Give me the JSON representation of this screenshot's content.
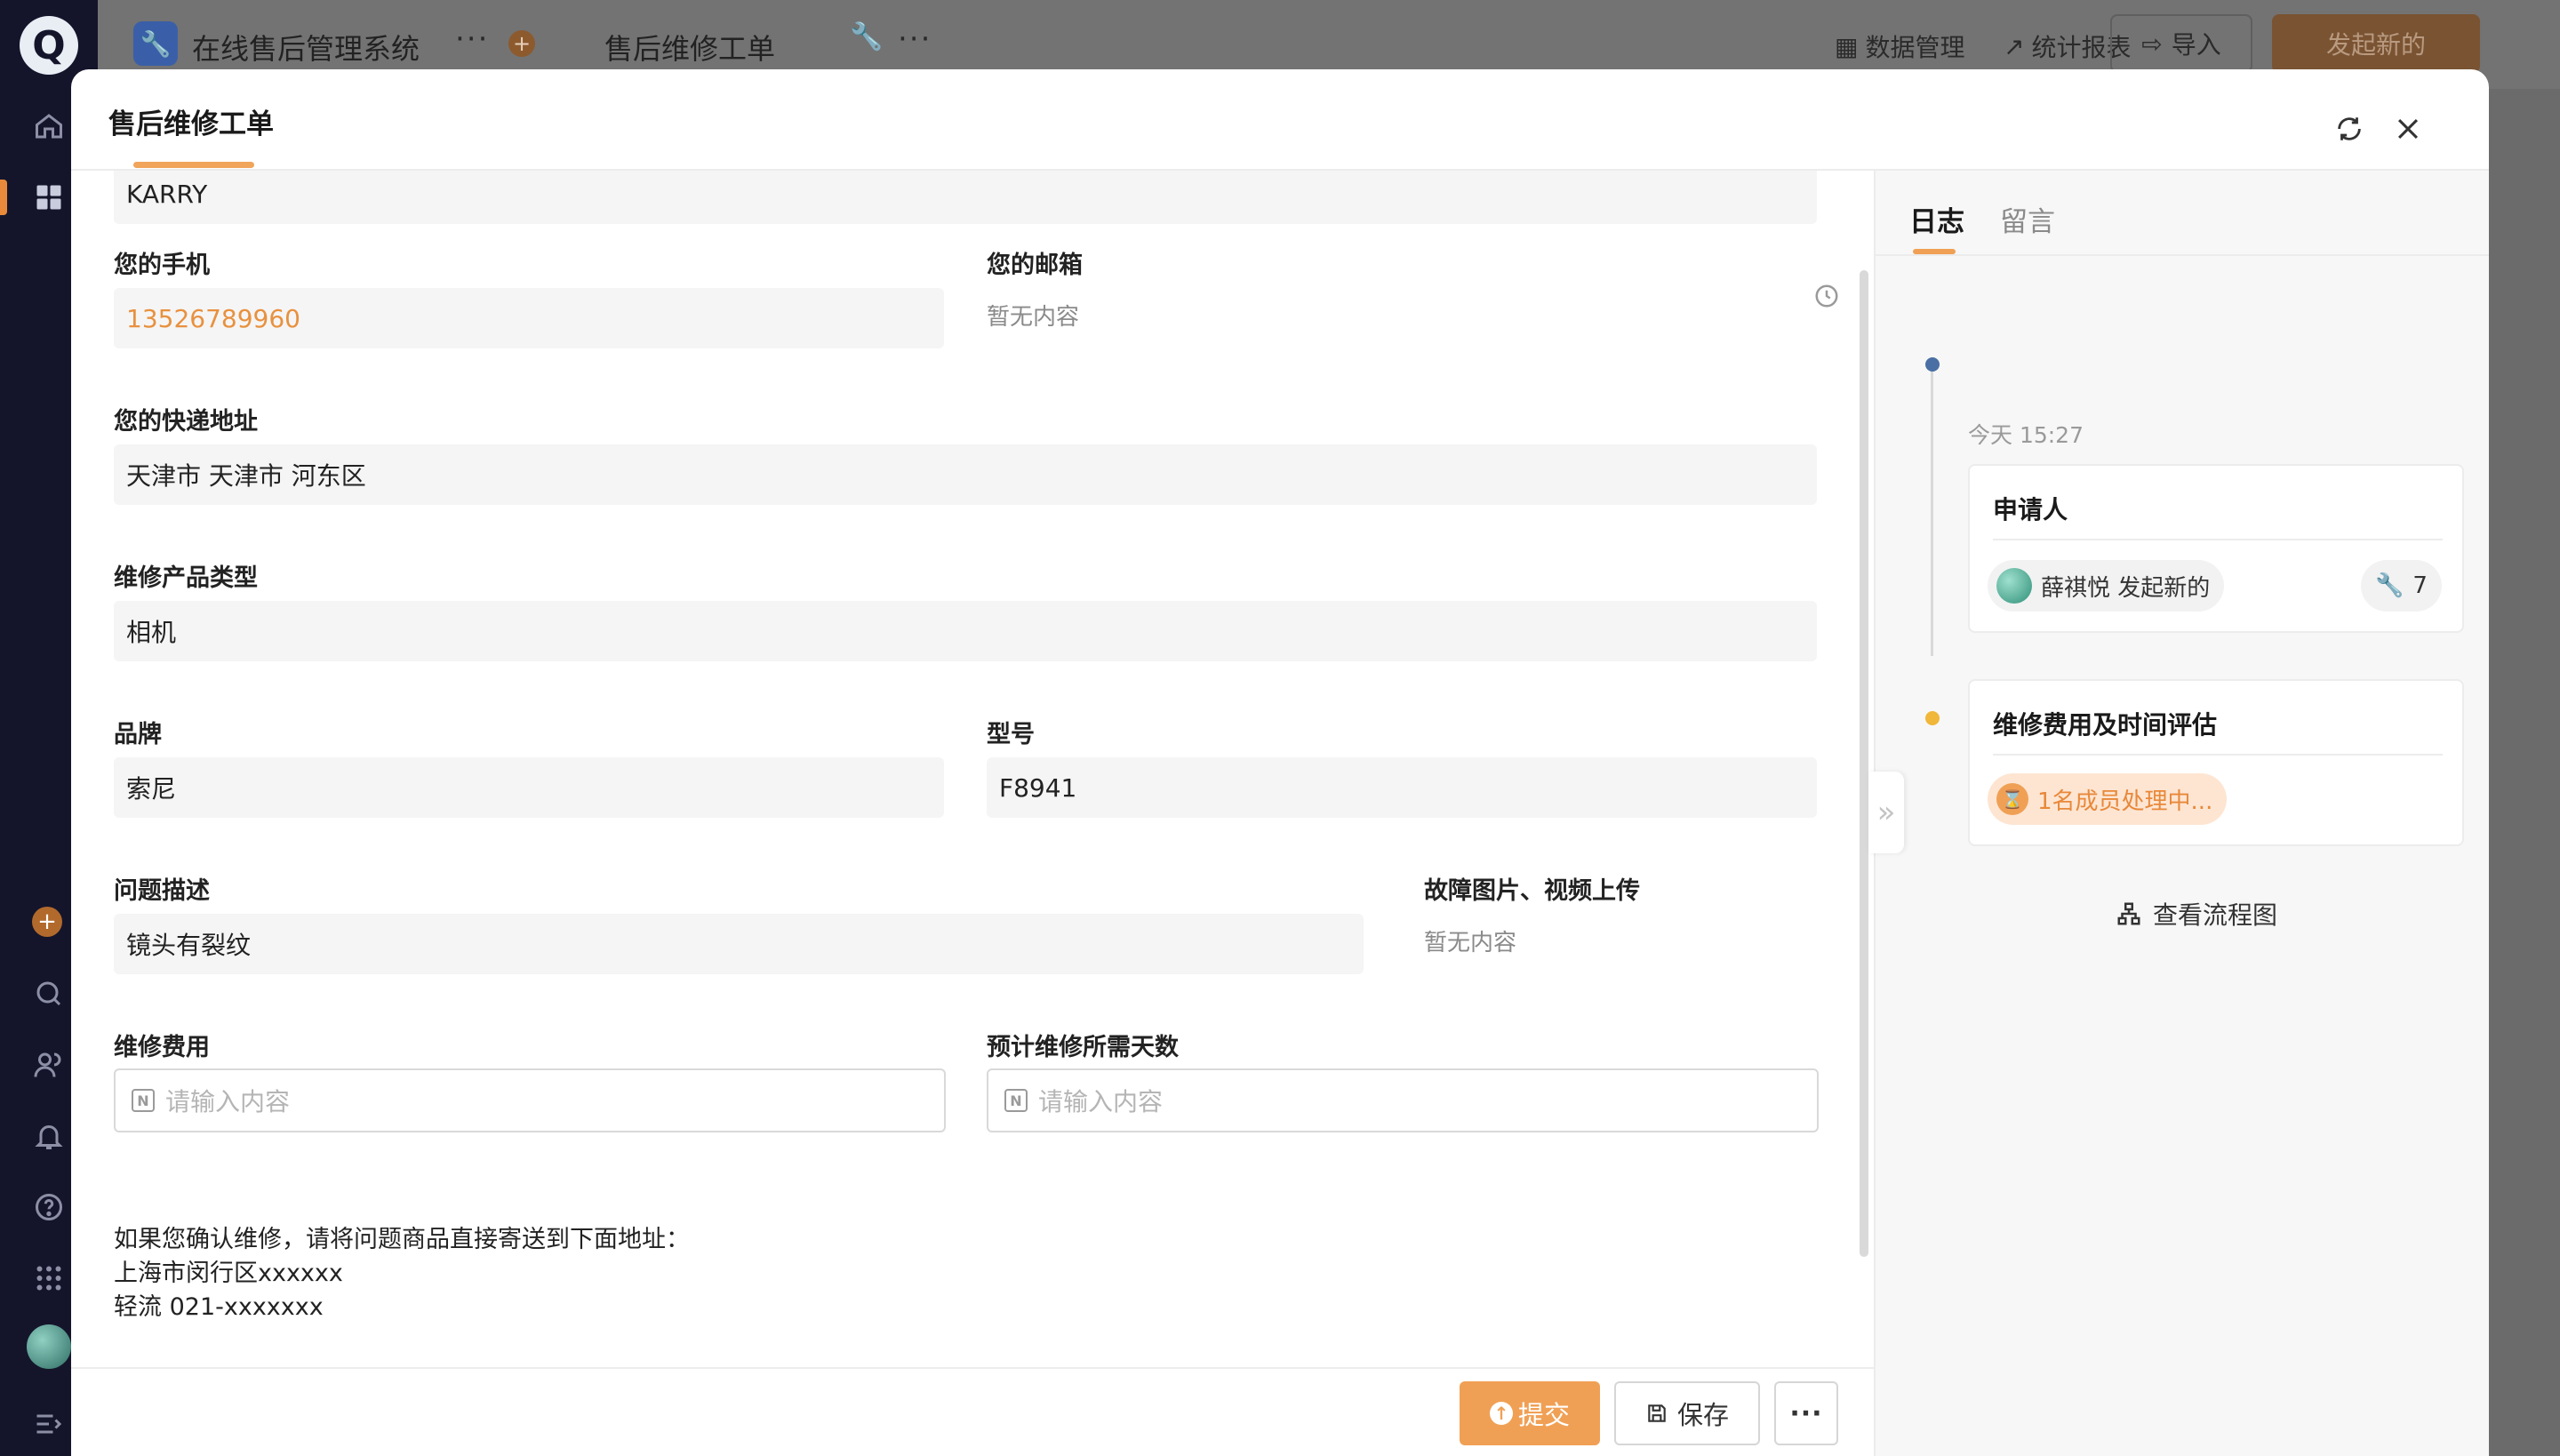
{
  "app": {
    "name": "在线售后管理系统",
    "module": "售后维修工单",
    "logo": "Q"
  },
  "topbar": {
    "data_manage": "数据管理",
    "stats_report": "统计报表",
    "import": "导入",
    "new": "发起新的"
  },
  "modal": {
    "title": "售后维修工单"
  },
  "form": {
    "name_value": "KARRY",
    "phone_label": "您的手机",
    "phone_value": "13526789960",
    "email_label": "您的邮箱",
    "email_empty": "暂无内容",
    "address_label": "您的快递地址",
    "address_value": "天津市 天津市 河东区",
    "product_type_label": "维修产品类型",
    "product_type_value": "相机",
    "brand_label": "品牌",
    "brand_value": "索尼",
    "model_label": "型号",
    "model_value": "F8941",
    "issue_label": "问题描述",
    "issue_value": "镜头有裂纹",
    "upload_label": "故障图片、视频上传",
    "upload_empty": "暂无内容",
    "fee_label": "维修费用",
    "fee_placeholder": "请输入内容",
    "days_label": "预计维修所需天数",
    "days_placeholder": "请输入内容",
    "note_line1": "如果您确认维修，请将问题商品直接寄送到下面地址：",
    "note_line2": "上海市闵行区xxxxxx",
    "note_line3": "轻流 021-xxxxxxx"
  },
  "footer": {
    "submit": "提交",
    "save": "保存",
    "more": "···"
  },
  "log_panel": {
    "tabs": [
      "日志",
      "留言"
    ],
    "time": "今天 15:27",
    "step1_title": "申请人",
    "step1_person": "薛祺悦 发起新的",
    "step1_count": "7",
    "step2_title": "维修费用及时间评估",
    "step2_status": "1名成员处理中...",
    "view_flow": "查看流程图"
  },
  "colors": {
    "accent": "#f0a055",
    "timeline_dot_done": "#4a6fa5",
    "timeline_dot_pending": "#f0b73a"
  }
}
